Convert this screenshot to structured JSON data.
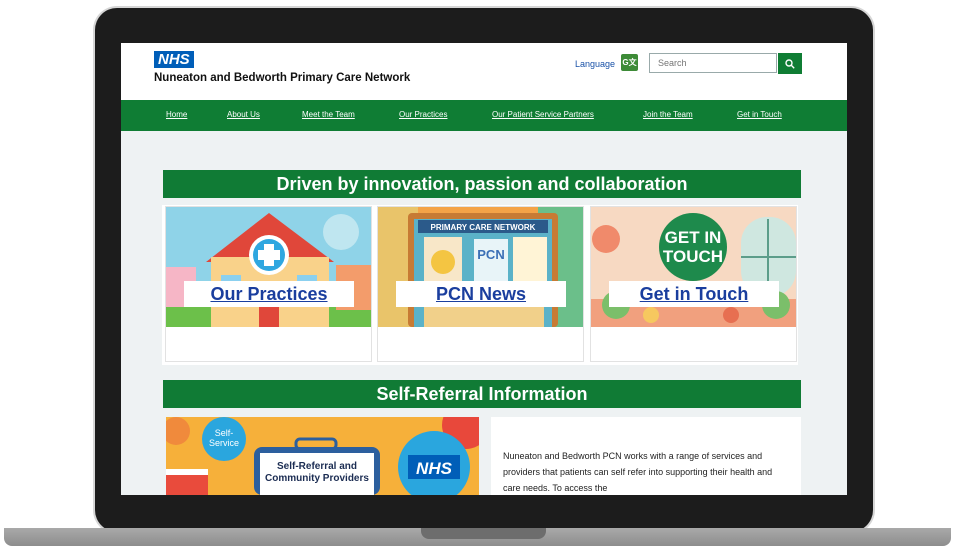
{
  "header": {
    "logo_text": "NHS",
    "org_name": "Nuneaton and Bedworth Primary Care Network",
    "language_label": "Language",
    "search_placeholder": "Search"
  },
  "nav": {
    "items": [
      "Home",
      "About Us",
      "Meet the Team",
      "Our Practices",
      "Our Patient Service Partners",
      "Join the Team",
      "Get in Touch"
    ]
  },
  "hero": {
    "banner": "Driven by innovation, passion and collaboration",
    "cards": [
      {
        "label": "Our Practices"
      },
      {
        "label": "PCN News",
        "image_sign": "PRIMARY CARE NETWORK",
        "image_tag": "PCN"
      },
      {
        "label": "Get in Touch",
        "image_line1": "GET IN",
        "image_line2": "TOUCH"
      }
    ]
  },
  "self_referral": {
    "banner": "Self-Referral Information",
    "image_badge_1": "Self-",
    "image_badge_2": "Service",
    "image_title_1": "Self-Referral and",
    "image_title_2": "Community Providers",
    "image_nhs": "NHS",
    "text": "Nuneaton and Bedworth PCN works with a range of services and providers that patients can self refer into supporting their health and care needs. To access the"
  },
  "colors": {
    "nhs_blue": "#005eb8",
    "brand_green": "#0f7d34",
    "link_blue": "#1a3e9e"
  }
}
